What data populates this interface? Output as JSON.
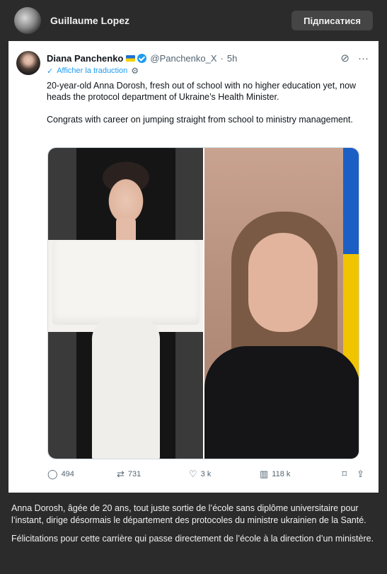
{
  "channel": {
    "name": "Guillaume Lopez",
    "subscribe_label": "Підписатися"
  },
  "tweet": {
    "author_name": "Diana Panchenko",
    "author_handle": "@Panchenko_X",
    "separator": "·",
    "time": "5h",
    "translate_label": "Afficher la traduction",
    "paragraphs": [
      "20-year-old Anna Dorosh, fresh out of school with no higher education yet, now heads the protocol department of Ukraine’s Health Minister.",
      "Congrats with career on jumping straight from school to ministry management."
    ],
    "stats": {
      "replies": "494",
      "reposts": "731",
      "likes": "3 k",
      "views": "118 k"
    }
  },
  "caption": {
    "paragraphs": [
      "Anna Dorosh, âgée de 20 ans, tout juste sortie de l’école sans diplôme universitaire pour l’instant, dirige désormais le département des protocoles du ministre ukrainien de la Santé.",
      "Félicitations pour cette carrière qui passe directement de l’école à la direction d’un ministère."
    ]
  },
  "colors": {
    "accent": "#1d9bf0",
    "page_bg": "#2b2b2b",
    "muted": "#536471"
  }
}
